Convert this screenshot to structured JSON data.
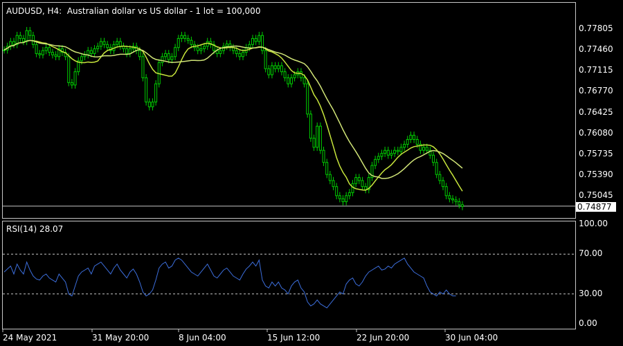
{
  "chart": {
    "title": "AUDUSD, H4:  Australian dollar vs US dollar - 1 lot = 100,000",
    "current_price": "0.74877",
    "price_ticks": [
      "0.77805",
      "0.77460",
      "0.77115",
      "0.76770",
      "0.76425",
      "0.76080",
      "0.75735",
      "0.75390",
      "0.75045"
    ],
    "time_labels": [
      "24 May 2021",
      "31 May 20:00",
      "8 Jun 04:00",
      "15 Jun 12:00",
      "22 Jun 20:00",
      "30 Jun 04:00"
    ],
    "colors": {
      "candles": "#00d000",
      "ma_fast": "#c8e63c",
      "ma_slow": "#d2e678",
      "rsi_line": "#3c6edc",
      "grid": "#c8c8c8"
    }
  },
  "rsi": {
    "title": "RSI(14) 28.07",
    "ticks": [
      "100.00",
      "70.00",
      "30.00",
      "0.00"
    ],
    "levels": [
      70,
      30
    ]
  },
  "chart_data": {
    "type": "line",
    "title": "AUDUSD, H4:  Australian dollar vs US dollar - 1 lot = 100,000",
    "close": [
      0.7746,
      0.7752,
      0.776,
      0.7755,
      0.777,
      0.7765,
      0.776,
      0.7778,
      0.777,
      0.7755,
      0.774,
      0.7738,
      0.7745,
      0.775,
      0.7742,
      0.7738,
      0.7735,
      0.7748,
      0.7742,
      0.7735,
      0.7692,
      0.7688,
      0.771,
      0.7728,
      0.7735,
      0.7738,
      0.7745,
      0.774,
      0.7748,
      0.7752,
      0.776,
      0.7755,
      0.775,
      0.7745,
      0.7755,
      0.776,
      0.7752,
      0.7748,
      0.774,
      0.7748,
      0.7752,
      0.7745,
      0.7735,
      0.77,
      0.766,
      0.7652,
      0.766,
      0.769,
      0.7725,
      0.7735,
      0.774,
      0.773,
      0.7735,
      0.775,
      0.7765,
      0.777,
      0.7765,
      0.7762,
      0.7755,
      0.775,
      0.7745,
      0.7748,
      0.7752,
      0.776,
      0.7755,
      0.7745,
      0.774,
      0.7745,
      0.7752,
      0.7756,
      0.775,
      0.7745,
      0.774,
      0.7735,
      0.7742,
      0.775,
      0.7755,
      0.7765,
      0.776,
      0.777,
      0.7745,
      0.7715,
      0.7705,
      0.772,
      0.7715,
      0.772,
      0.771,
      0.77,
      0.769,
      0.77,
      0.7705,
      0.771,
      0.77,
      0.769,
      0.764,
      0.76,
      0.7585,
      0.762,
      0.758,
      0.756,
      0.754,
      0.753,
      0.752,
      0.7505,
      0.75,
      0.7495,
      0.7505,
      0.751,
      0.7525,
      0.7535,
      0.753,
      0.752,
      0.7515,
      0.7535,
      0.7555,
      0.7565,
      0.757,
      0.7575,
      0.758,
      0.7572,
      0.7575,
      0.758,
      0.7578,
      0.7585,
      0.759,
      0.7598,
      0.7605,
      0.7598,
      0.759,
      0.758,
      0.7585,
      0.758,
      0.7572,
      0.756,
      0.754,
      0.753,
      0.752,
      0.7505,
      0.75,
      0.7498,
      0.7495,
      0.749,
      0.7487
    ],
    "ylim": [
      0.7483,
      0.78
    ],
    "rsi": [
      52,
      55,
      58,
      50,
      60,
      54,
      50,
      62,
      54,
      48,
      45,
      44,
      48,
      50,
      46,
      44,
      42,
      50,
      46,
      42,
      30,
      28,
      38,
      48,
      52,
      54,
      56,
      50,
      58,
      60,
      62,
      58,
      54,
      50,
      56,
      60,
      54,
      50,
      46,
      52,
      55,
      50,
      42,
      32,
      28,
      30,
      34,
      44,
      56,
      60,
      62,
      56,
      58,
      64,
      66,
      64,
      60,
      56,
      52,
      50,
      48,
      52,
      56,
      60,
      54,
      48,
      46,
      50,
      54,
      56,
      52,
      48,
      46,
      44,
      50,
      55,
      58,
      62,
      58,
      64,
      44,
      38,
      36,
      42,
      38,
      42,
      36,
      34,
      30,
      38,
      42,
      44,
      36,
      32,
      22,
      18,
      20,
      24,
      20,
      18,
      16,
      20,
      24,
      28,
      32,
      30,
      40,
      44,
      46,
      40,
      38,
      42,
      48,
      52,
      54,
      56,
      58,
      54,
      55,
      58,
      56,
      60,
      62,
      64,
      66,
      60,
      56,
      52,
      50,
      48,
      46,
      38,
      32,
      30,
      28,
      32,
      30,
      34,
      30,
      28,
      28
    ]
  }
}
